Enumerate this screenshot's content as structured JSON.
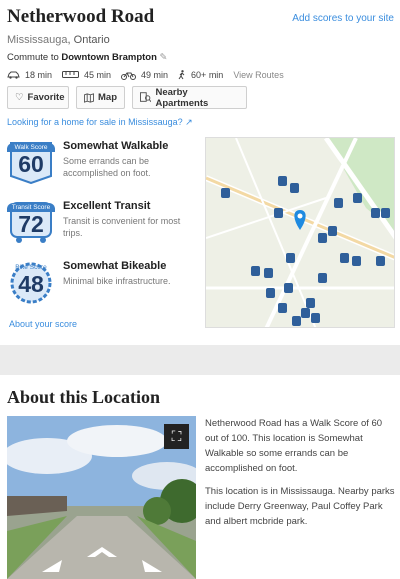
{
  "header": {
    "title": "Netherwood Road",
    "city": "Mississauga",
    "province": ", Ontario",
    "add_scores": "Add scores to your site",
    "commute_prefix": "Commute to ",
    "commute_dest": "Downtown Brampton"
  },
  "commute": {
    "drive": "18 min",
    "transit": "45 min",
    "bike": "49 min",
    "walk": "60+ min",
    "view_routes": "View Routes"
  },
  "buttons": {
    "favorite": "Favorite",
    "map": "Map",
    "nearby": "Nearby Apartments"
  },
  "home_sale_link": "Looking for a home for sale in Mississauga?",
  "scores": [
    {
      "label": "Walk Score",
      "value": "60",
      "title": "Somewhat Walkable",
      "desc": "Some errands can be accomplished on foot."
    },
    {
      "label": "Transit Score",
      "value": "72",
      "title": "Excellent Transit",
      "desc": "Transit is convenient for most trips."
    },
    {
      "label": "Bike Score",
      "value": "48",
      "title": "Somewhat Bikeable",
      "desc": "Minimal bike infrastructure."
    }
  ],
  "about_score": "About your score",
  "about": {
    "title": "About this Location",
    "p1": "Netherwood Road has a Walk Score of 60 out of 100. This location is Somewhat Walkable so some errands can be accomplished on foot.",
    "p2": "This location is in Mississauga. Nearby parks include Derry Greenway, Paul Coffey Park and albert mcbride park."
  },
  "colors": {
    "link": "#3a8dde",
    "badge": "#3a7ec6",
    "score_num": "#1f3b66"
  }
}
